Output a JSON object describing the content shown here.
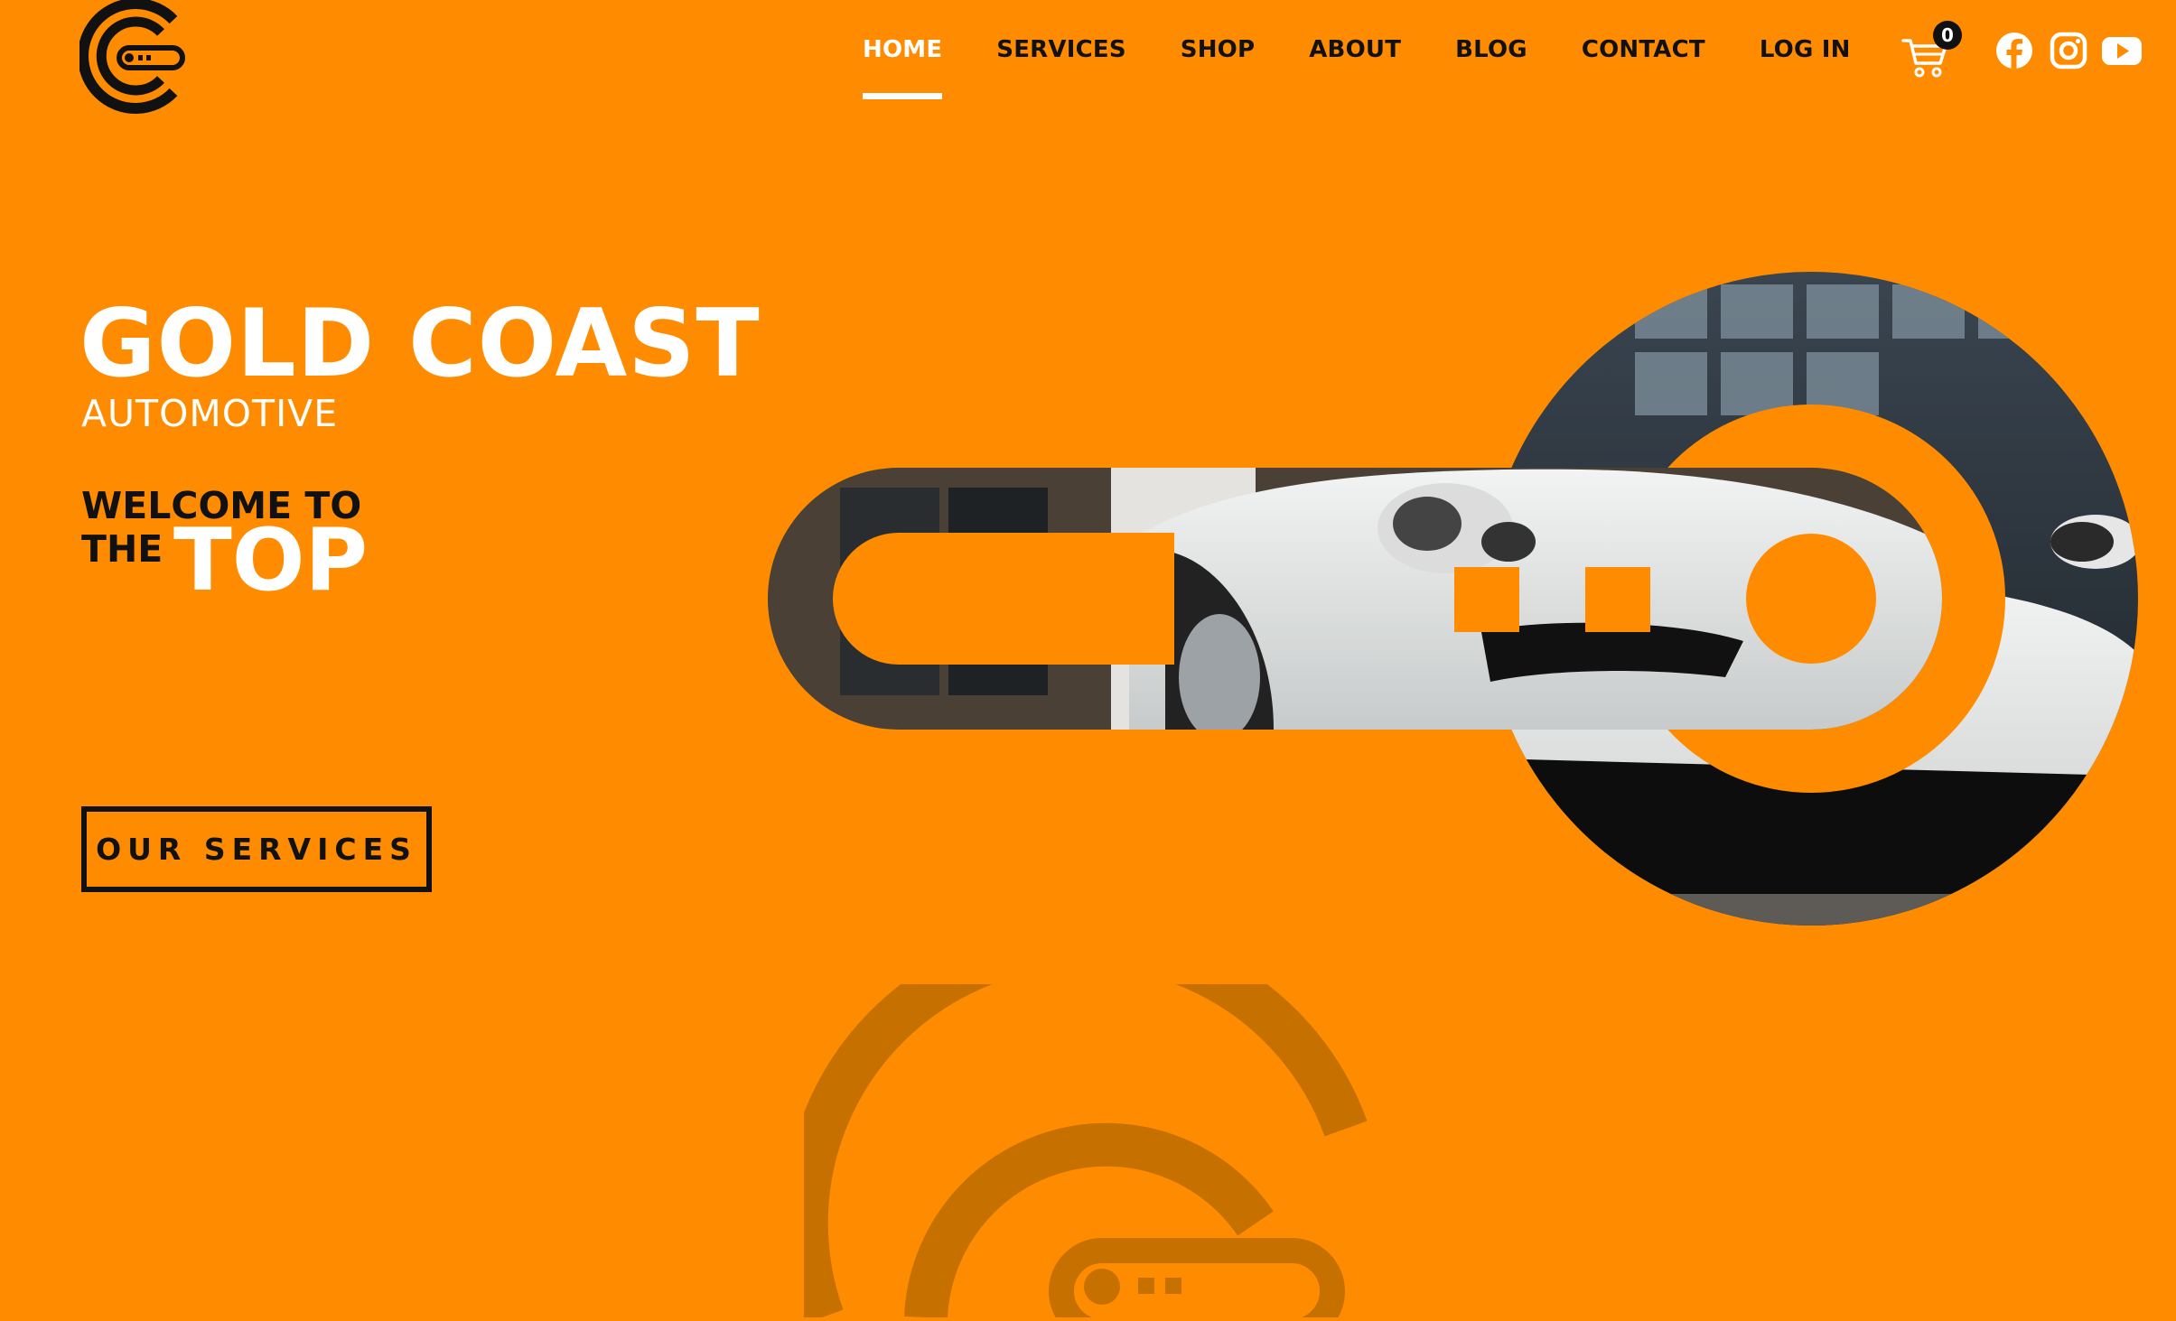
{
  "theme": {
    "background": "#FF8C00",
    "emblem_shade": "#C67000",
    "text_dark": "#111111",
    "text_light": "#FFFFFF"
  },
  "brand": {
    "logo_icon": "gold-coast-c-logo-icon"
  },
  "nav": {
    "items": [
      {
        "label": "HOME",
        "active": true
      },
      {
        "label": "SERVICES",
        "active": false
      },
      {
        "label": "SHOP",
        "active": false
      },
      {
        "label": "ABOUT",
        "active": false
      },
      {
        "label": "BLOG",
        "active": false
      },
      {
        "label": "CONTACT",
        "active": false
      },
      {
        "label": "LOG IN",
        "active": false
      }
    ]
  },
  "cart": {
    "icon": "cart-icon",
    "count": "0"
  },
  "social": [
    {
      "icon": "facebook-icon"
    },
    {
      "icon": "instagram-icon"
    },
    {
      "icon": "youtube-icon"
    }
  ],
  "hero": {
    "title": "GOLD COAST",
    "subtitle": "AUTOMOTIVE",
    "welcome_line1": "WELCOME TO",
    "welcome_the": "THE",
    "welcome_top": "TOP",
    "cta_label": "OUR SERVICES",
    "image_icon": "car-photo-in-logo-shape"
  }
}
